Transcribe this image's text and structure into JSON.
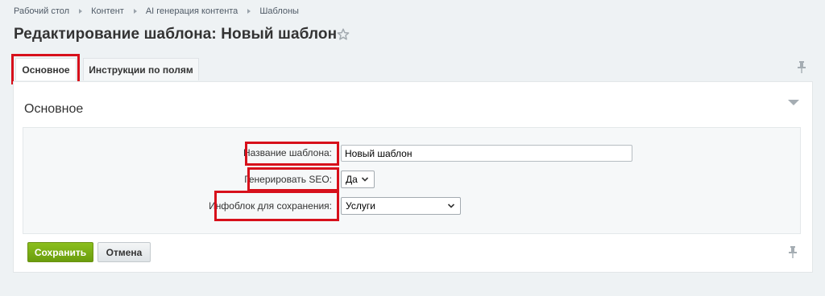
{
  "breadcrumb": {
    "items": [
      "Рабочий стол",
      "Контент",
      "AI генерация контента",
      "Шаблоны"
    ]
  },
  "page": {
    "title": "Редактирование шаблона: Новый шаблон"
  },
  "tabs": [
    {
      "label": "Основное",
      "active": true,
      "highlighted": true
    },
    {
      "label": "Инструкции по полям",
      "active": false,
      "highlighted": false
    }
  ],
  "section": {
    "title": "Основное"
  },
  "form": {
    "name_label": "Название шаблона:",
    "name_value": "Новый шаблон",
    "seo_label": "Генерировать SEO:",
    "seo_value": "Да",
    "iblock_label": "Инфоблок для сохранения:",
    "iblock_value": "Услуги"
  },
  "buttons": {
    "save_label": "Сохранить",
    "cancel_label": "Отмена"
  },
  "colors": {
    "highlight": "#d7101b",
    "save_button": "#7aae16",
    "background": "#eef2f4"
  },
  "icons": [
    "star-icon",
    "pin-icon",
    "chevron-down-icon"
  ]
}
